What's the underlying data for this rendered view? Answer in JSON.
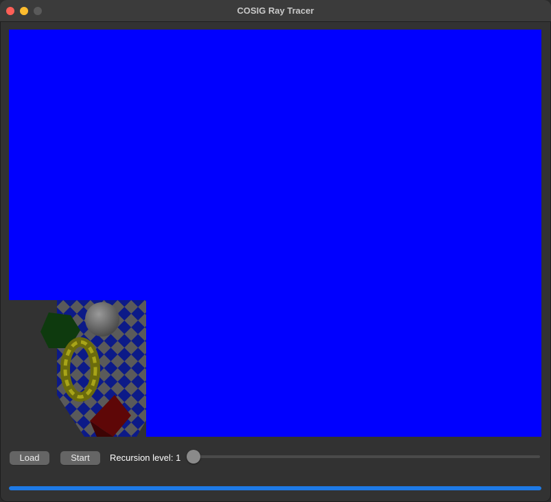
{
  "window": {
    "title": "COSIG Ray Tracer"
  },
  "canvas": {
    "background_color": "#0000ff"
  },
  "controls": {
    "load_label": "Load",
    "start_label": "Start",
    "recursion_prefix": "Recursion level: ",
    "recursion_value": "1"
  },
  "progress": {
    "fraction": 1.0,
    "color": "#1e7ae6"
  }
}
